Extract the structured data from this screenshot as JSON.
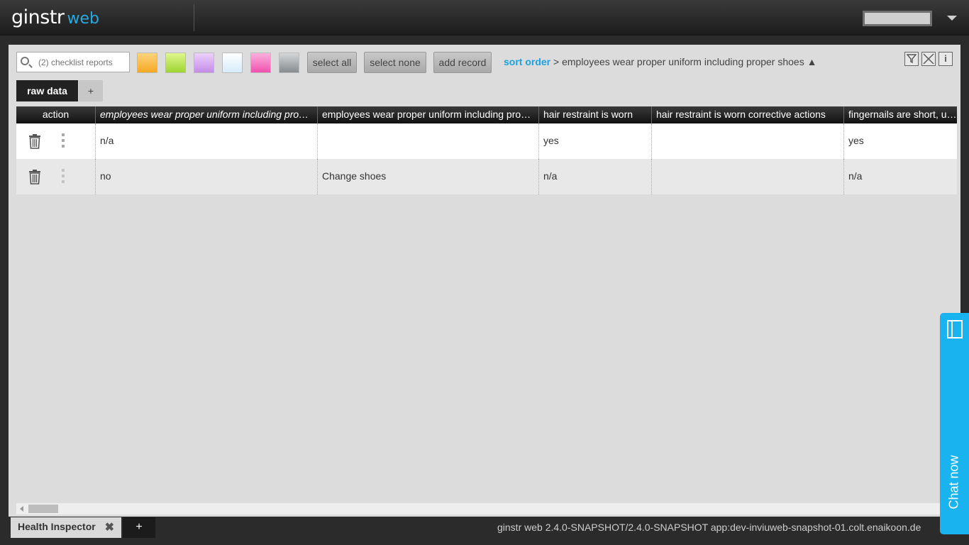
{
  "app": {
    "logo_main": "ginstr",
    "logo_sub": "web"
  },
  "toolbar": {
    "search_placeholder": "(2) checklist reports",
    "swatches": [
      "#fbc14d",
      "#c8f05a",
      "#d9a7f0",
      "#e6f3fb",
      "#f76fc0",
      "#9fa3a5"
    ],
    "select_all": "select all",
    "select_none": "select none",
    "add_record": "add record",
    "sort_key": "sort order",
    "sort_value": " > employees wear proper uniform including proper shoes ▲",
    "filter_icon": "funnel-icon",
    "clear_icon": "clear-filter-icon",
    "info_icon": "info-icon"
  },
  "views": {
    "active": "raw  data",
    "add": "+"
  },
  "table": {
    "headers": [
      "action",
      "employees wear proper uniform including pro…",
      "employees wear proper uniform including pro…",
      "hair restraint is worn",
      "hair restraint is worn corrective actions",
      "fingernails are short, unp"
    ],
    "rows": [
      [
        "",
        "n/a",
        "",
        "yes",
        "",
        "yes"
      ],
      [
        "",
        "no",
        "Change shoes",
        "n/a",
        "",
        "n/a"
      ]
    ]
  },
  "bottom": {
    "tab_label": "Health Inspector",
    "tab_close": "✖",
    "tab_add": "+",
    "version": "ginstr web 2.4.0-SNAPSHOT/2.4.0-SNAPSHOT app:dev-inviuweb-snapshot-01.colt.enaikoon.de"
  },
  "chat": {
    "label": "Chat now"
  }
}
